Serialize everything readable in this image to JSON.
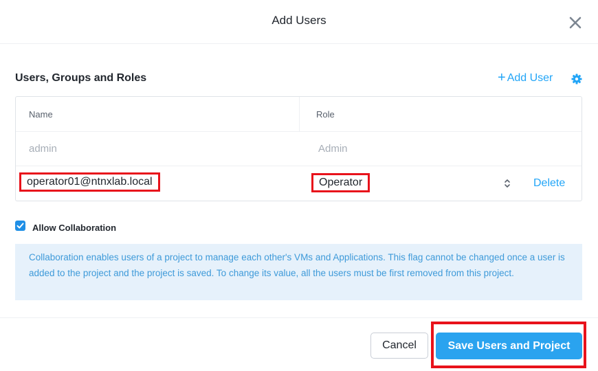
{
  "dialog": {
    "title": "Add Users"
  },
  "section": {
    "title": "Users, Groups and Roles",
    "add_user_label": "Add User",
    "add_icon": "plus-icon",
    "settings_icon": "gear-icon"
  },
  "table": {
    "headers": {
      "name": "Name",
      "role": "Role"
    },
    "rows": [
      {
        "name": "admin",
        "role": "Admin"
      },
      {
        "name": "operator01@ntnxlab.local",
        "role": "Operator",
        "action": "Delete"
      }
    ]
  },
  "collaboration": {
    "checked": true,
    "label": "Allow Collaboration",
    "info": "Collaboration enables users of a project to manage each other's VMs and Applications. This flag cannot be changed once a user is added to the project and the project is saved. To change its value, all the users must be first removed from this project."
  },
  "footer": {
    "cancel_label": "Cancel",
    "save_label": "Save Users and Project"
  },
  "colors": {
    "accent": "#22a5f7",
    "highlight": "#e8121b",
    "primary_button": "#2aa3ef",
    "info_bg": "#e6f1fb"
  }
}
